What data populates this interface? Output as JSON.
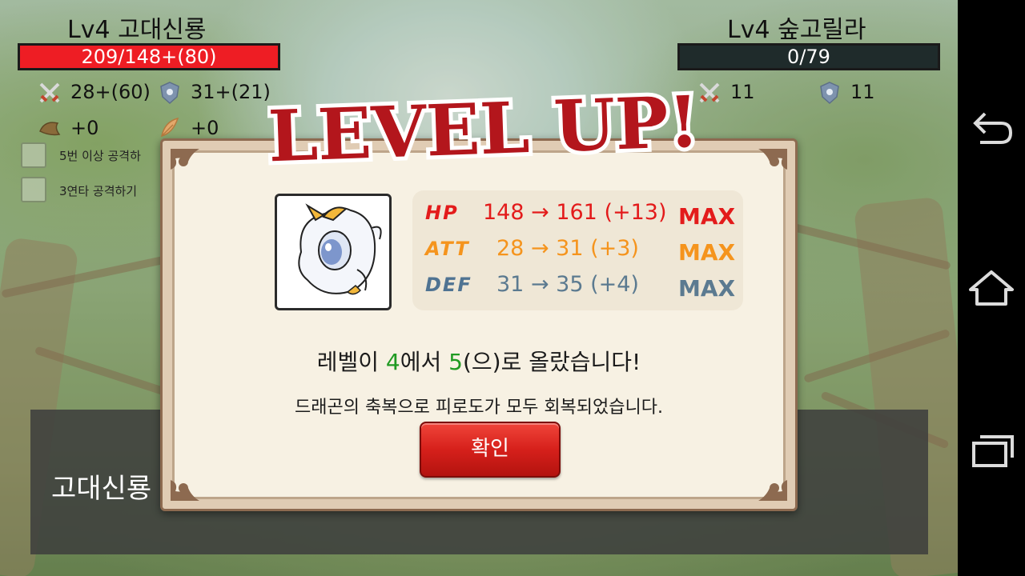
{
  "player": {
    "name": "Lv4 고대신룡",
    "hp_text": "209/148+(80)",
    "hp_fill": 1.0,
    "attack": "28+(60)",
    "defense": "31+(21)",
    "item1": "+0",
    "item2": "+0"
  },
  "enemy": {
    "name": "Lv4 숲고릴라",
    "hp_text": "0/79",
    "hp_fill": 0,
    "attack": "11",
    "defense": "11"
  },
  "options": [
    {
      "label": "5번 이상 공격하"
    },
    {
      "label": "3연타 공격하기"
    }
  ],
  "bottom_panel": {
    "name": "고대신룡"
  },
  "levelup": {
    "title": "LEVEL UP!",
    "stats": [
      {
        "label": "HP",
        "value": "148 → 161 (+13)",
        "max": "MAX",
        "color": "#e31b1b",
        "label_color": "#e31b1b"
      },
      {
        "label": "ATT",
        "value": "28 → 31 (+3)",
        "max": "MAX",
        "color": "#f5941d",
        "label_color": "#f5941d"
      },
      {
        "label": "DEF",
        "value": "31 → 35 (+4)",
        "max": "MAX",
        "color": "#5b7a90",
        "label_color": "#4f7392"
      }
    ],
    "message_prefix": "레벨이 ",
    "level_from": "4",
    "message_mid": "에서 ",
    "level_to": "5",
    "message_suffix": "(으)로 올랐습니다!",
    "message2": "드래곤의 축복으로 피로도가 모두 회복되었습니다.",
    "confirm_label": "확인"
  },
  "colors": {
    "hp_red": "#ee1d24",
    "button_red": "#d6201b",
    "level_green": "#1f9a22"
  },
  "icons": [
    "sword-icon",
    "shield-icon",
    "horn-icon",
    "feather-icon",
    "back-icon",
    "home-icon",
    "recents-icon"
  ]
}
